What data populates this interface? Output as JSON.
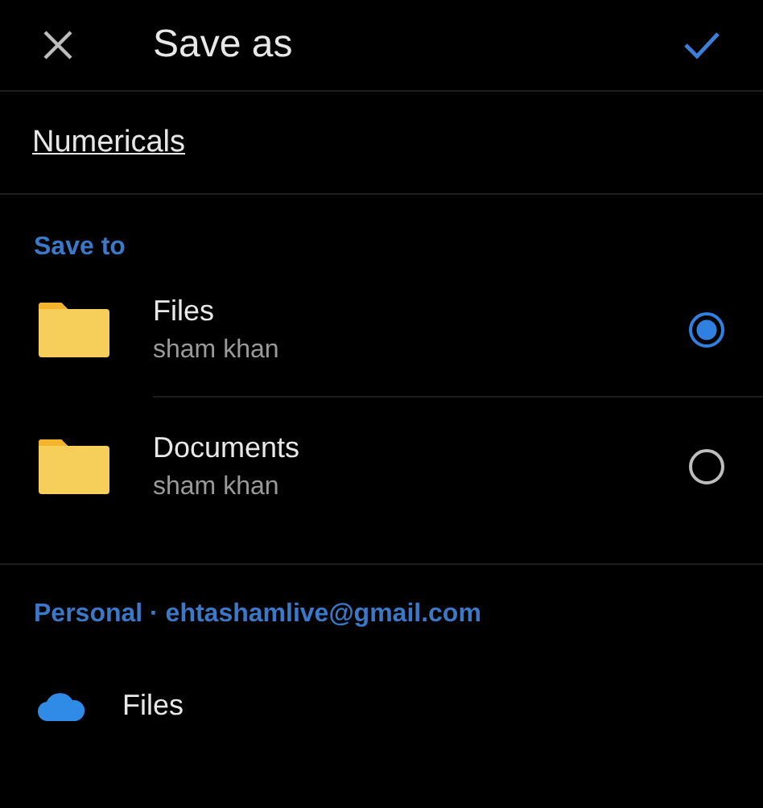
{
  "header": {
    "title": "Save as"
  },
  "file_name": {
    "value": "Numericals"
  },
  "sections": [
    {
      "label": "Save to",
      "items": [
        {
          "kind": "folder",
          "name": "Files",
          "owner": "sham khan",
          "selected": true
        },
        {
          "kind": "folder",
          "name": "Documents",
          "owner": "sham khan",
          "selected": false
        }
      ]
    },
    {
      "label": "Personal · ehtashamlive@gmail.com",
      "items": [
        {
          "kind": "cloud",
          "name": "Files"
        }
      ]
    }
  ]
}
